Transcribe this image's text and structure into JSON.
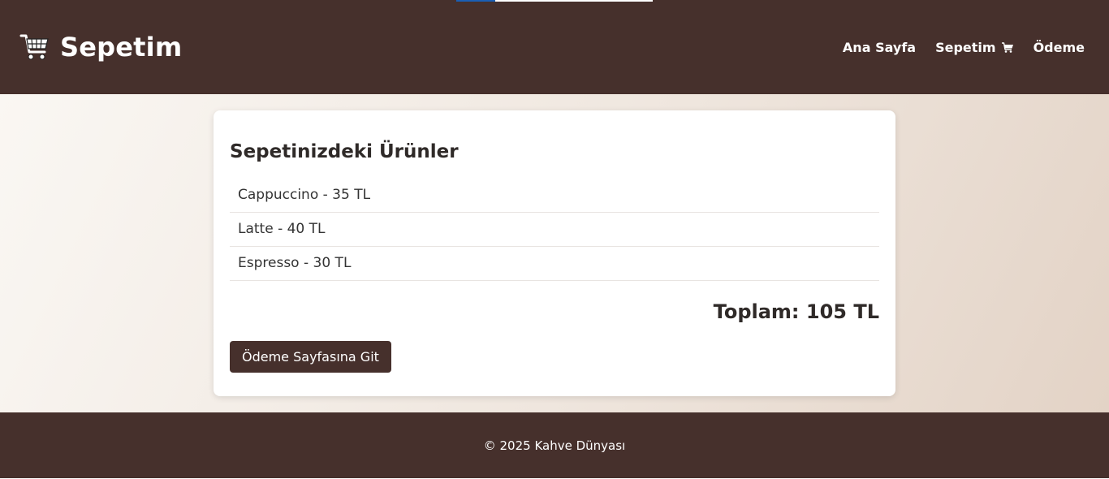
{
  "header": {
    "brand_icon": "shopping-cart-icon",
    "title": "Sepetim",
    "nav": [
      {
        "label": "Ana Sayfa"
      },
      {
        "label": "Sepetim",
        "icon": "shopping-cart-icon"
      },
      {
        "label": "Ödeme"
      }
    ]
  },
  "cart": {
    "heading": "Sepetinizdeki Ürünler",
    "items": [
      {
        "text": "Cappuccino - 35 TL"
      },
      {
        "text": "Latte - 40 TL"
      },
      {
        "text": "Espresso - 30 TL"
      }
    ],
    "total": "Toplam: 105 TL",
    "checkout_label": "Ödeme Sayfasına Git"
  },
  "footer": {
    "text": "© 2025 Kahve Dünyası"
  },
  "colors": {
    "header_bg": "#46302c",
    "button_bg": "#46302c",
    "card_bg": "#ffffff"
  }
}
